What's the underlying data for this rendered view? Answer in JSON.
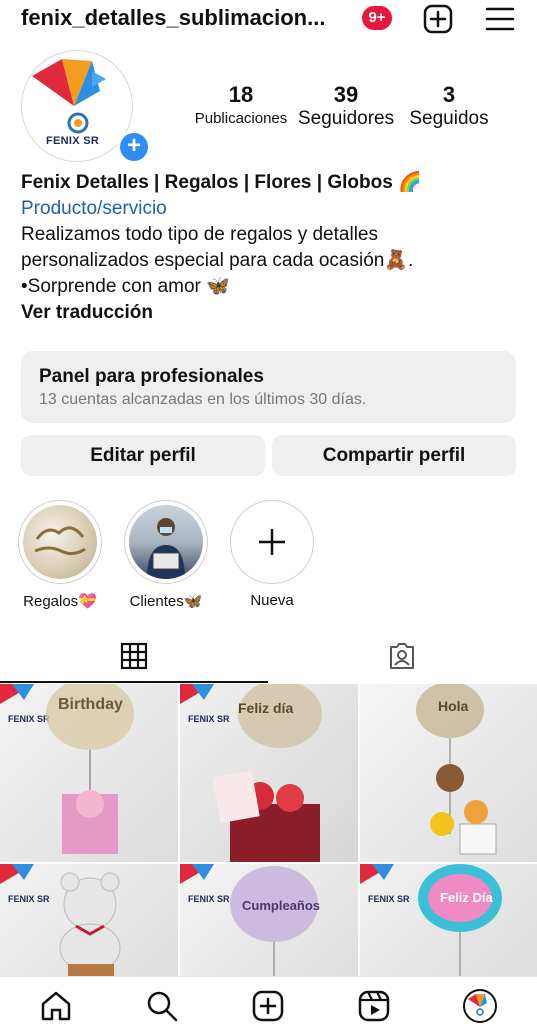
{
  "header": {
    "username": "fenix_detalles_sublimacion...",
    "notifications": "9+",
    "icons": [
      "plus-square-icon",
      "menu-icon"
    ]
  },
  "profile": {
    "avatar_brand": "FENIX SR",
    "stats": [
      {
        "value": "18",
        "label": "Publicaciones"
      },
      {
        "value": "39",
        "label": "Seguidores"
      },
      {
        "value": "3",
        "label": "Seguidos"
      }
    ],
    "name": "Fenix Detalles | Regalos | Flores | Globos 🌈",
    "category": "Producto/servicio",
    "bio_line1": "Realizamos todo tipo de regalos y detalles",
    "bio_line2": "personalizados especial para cada ocasión🧸.",
    "bio_line3": "•Sorprende con amor 🦋",
    "translate": "Ver traducción"
  },
  "pro_panel": {
    "title": "Panel para profesionales",
    "subtitle": "13 cuentas alcanzadas en los últimos 30 días."
  },
  "buttons": {
    "edit": "Editar perfil",
    "share": "Compartir perfil"
  },
  "highlights": [
    {
      "label": "Regalos💝"
    },
    {
      "label": "Clientes🦋"
    },
    {
      "label": "Nueva"
    }
  ],
  "tabs": [
    "grid-icon",
    "tagged-icon"
  ],
  "posts": [
    {
      "text": "Birthday"
    },
    {
      "text": "Feliz día"
    },
    {
      "text": "Hola"
    },
    {
      "text": ""
    },
    {
      "text": "Cumpleaños"
    },
    {
      "text": "Feliz Día"
    }
  ],
  "bottom_nav": [
    "home-icon",
    "search-icon",
    "create-icon",
    "reels-icon",
    "profile-avatar"
  ],
  "colors": {
    "accent": "#2f8df5",
    "badge": "#e8163c",
    "category": "#1f5fb0",
    "button_bg": "#efefef"
  }
}
